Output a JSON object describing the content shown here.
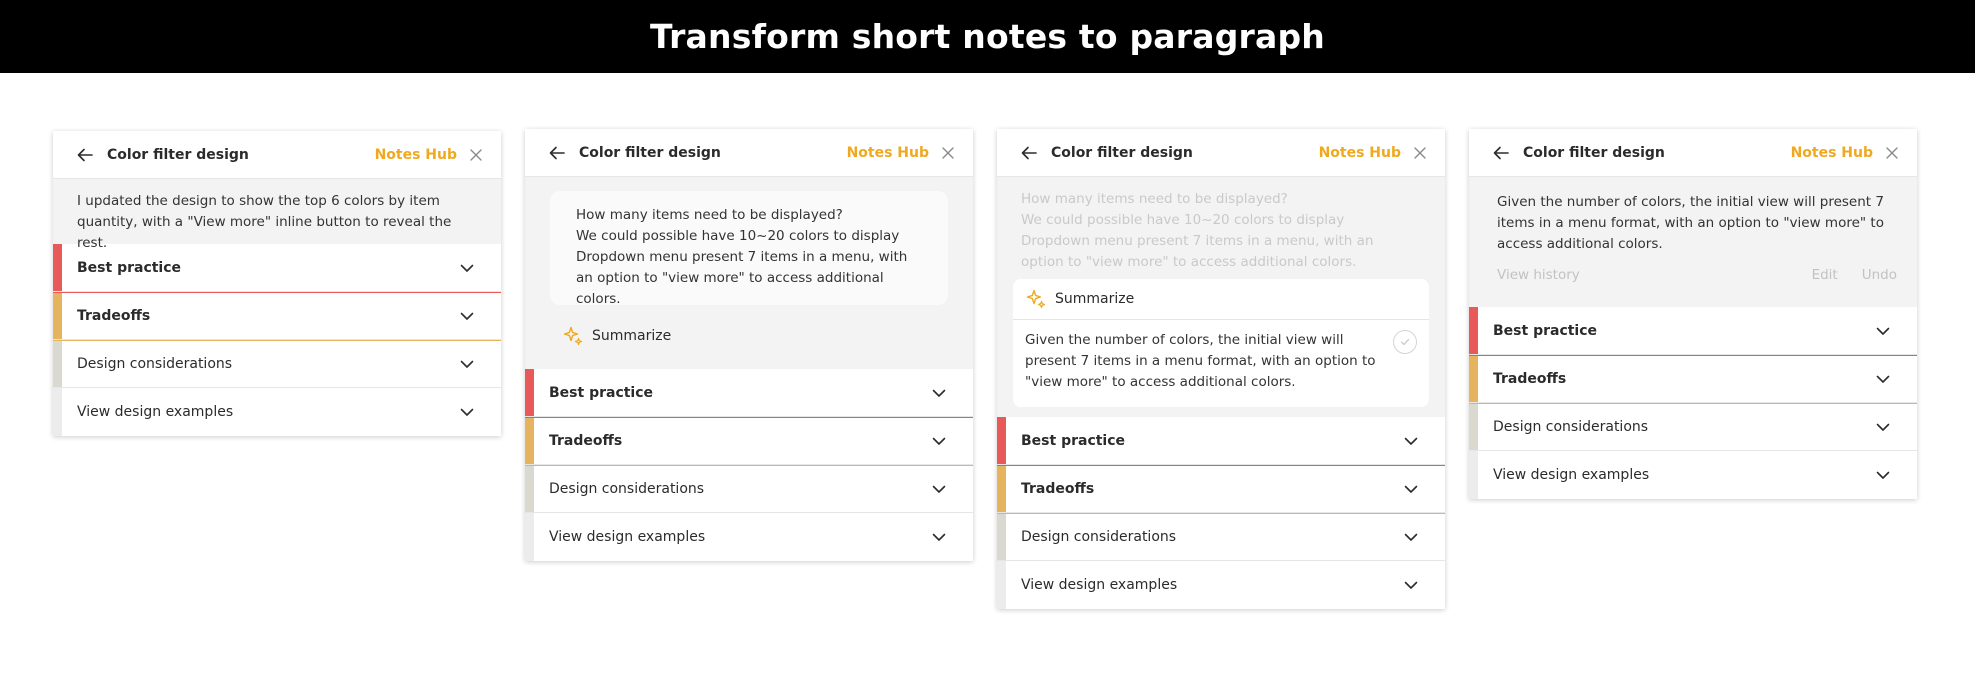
{
  "banner": {
    "title": "Transform short notes to paragraph"
  },
  "colors": {
    "brand": "#f0a91e",
    "best_practice_bar": "#e8595a",
    "tradeoffs_bar": "#e6b35e",
    "design_considerations_bar": "#dad9cf",
    "view_examples_bar": "#ececec"
  },
  "panels": [
    {
      "title": "Color filter design",
      "brand": "Notes Hub",
      "note": "I updated the design to show the top 6 colors by item quantity, with a \"View more\" inline button to reveal the rest."
    },
    {
      "title": "Color filter design",
      "brand": "Notes Hub",
      "draft": [
        "How many items need to be displayed?",
        "We could possible have 10~20 colors to display",
        "Dropdown menu present 7 items in a menu, with an option to \"view more\" to access additional colors."
      ],
      "summarize_label": "Summarize"
    },
    {
      "title": "Color filter design",
      "brand": "Notes Hub",
      "draft": [
        "How many items need to be displayed?",
        "We could possible have 10~20 colors to display",
        "Dropdown menu present 7 items in a menu, with an option to \"view more\" to access additional colors."
      ],
      "summarize_label": "Summarize",
      "summary": "Given the number of colors, the initial view will present 7 items in a menu format, with an option to \"view more\" to access additional colors."
    },
    {
      "title": "Color filter design",
      "brand": "Notes Hub",
      "summary": "Given the number of colors, the initial view will present 7 items in a menu format, with an option to \"view more\" to access additional colors.",
      "view_history": "View history",
      "edit": "Edit",
      "undo": "Undo"
    }
  ],
  "accordion": [
    {
      "label": "Best practice",
      "bold": true
    },
    {
      "label": "Tradeoffs",
      "bold": true
    },
    {
      "label": "Design considerations",
      "bold": false
    },
    {
      "label": "View design examples",
      "bold": false
    }
  ],
  "icons": {
    "back": "arrow-left-icon",
    "close": "close-icon",
    "chevron": "chevron-down-icon",
    "summarize": "sparkle-icon",
    "check": "check-circle-icon"
  }
}
